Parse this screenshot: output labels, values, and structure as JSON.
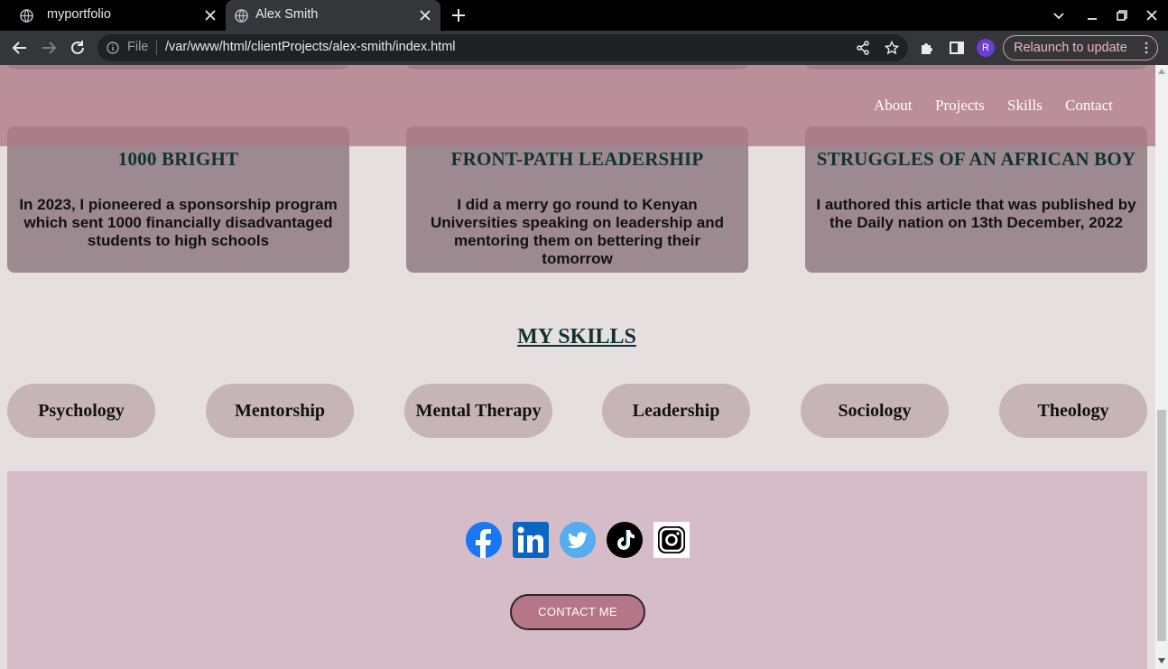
{
  "browser": {
    "tabs": [
      {
        "title": "myportfolio"
      },
      {
        "title": "Alex Smith"
      }
    ],
    "address": {
      "scheme_label": "File",
      "url": "/var/www/html/clientProjects/alex-smith/index.html"
    },
    "profile_initial": "R",
    "relaunch_label": "Relaunch to update",
    "accent_colors": {
      "relaunch": "#f5b5b5",
      "avatar": "#6a3fcf"
    }
  },
  "page": {
    "nav": {
      "links": [
        "About",
        "Projects",
        "Skills",
        "Contact"
      ]
    },
    "projects": [
      {
        "title": "1000 BRIGHT",
        "description": "In 2023, I pioneered a sponsorship program which sent 1000 financially disadvantaged students to high schools"
      },
      {
        "title": "FRONT-PATH LEADERSHIP",
        "description": "I did a merry go round to Kenyan Universities speaking on leadership and mentoring them on bettering their tomorrow"
      },
      {
        "title": "STRUGGLES OF AN AFRICAN BOY",
        "description": "I authored this article that was published by the Daily nation on 13th December, 2022"
      }
    ],
    "skills_heading": "MY SKILLS",
    "skills": [
      "Psychology",
      "Mentorship",
      "Mental Therapy",
      "Leadership",
      "Sociology",
      "Theology"
    ],
    "footer": {
      "social": [
        "facebook-icon",
        "linkedin-icon",
        "twitter-icon",
        "tiktok-icon",
        "instagram-icon"
      ],
      "contact_label": "CONTACT ME"
    },
    "colors": {
      "navbar": "#b07886",
      "card": "#9c8a90",
      "skill_pill": "#c6b4b9",
      "footer": "#d6bcc8",
      "contact_button": "#b57788"
    }
  }
}
